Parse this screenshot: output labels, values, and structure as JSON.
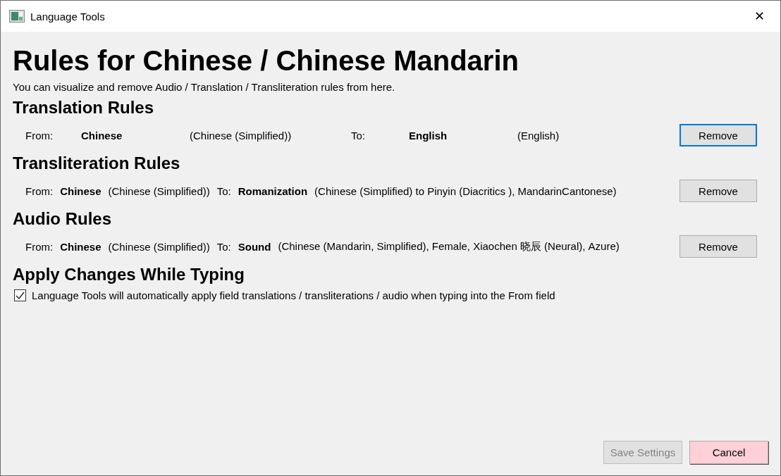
{
  "window": {
    "title": "Language Tools",
    "close": "✕"
  },
  "heading": "Rules for Chinese / Chinese Mandarin",
  "description": "You can visualize and remove Audio / Translation / Transliteration rules from here.",
  "sections": [
    {
      "title": "Translation Rules",
      "rule": {
        "kind": "spread",
        "from_label": "From:",
        "from": "Chinese",
        "from_detail": "(Chinese (Simplified))",
        "to_label": "To:",
        "to": "English",
        "to_detail": "(English)",
        "button": "Remove",
        "focused": true
      }
    },
    {
      "title": "Transliteration Rules",
      "rule": {
        "kind": "compact",
        "from_label": "From:",
        "from": "Chinese",
        "from_detail": "(Chinese (Simplified))",
        "to_label": "To:",
        "to": "Romanization",
        "to_detail": "(Chinese (Simplified) to Pinyin (Diacritics ), MandarinCantonese)",
        "button": "Remove",
        "focused": false
      }
    },
    {
      "title": "Audio Rules",
      "rule": {
        "kind": "compact",
        "from_label": "From:",
        "from": "Chinese",
        "from_detail": "(Chinese (Simplified))",
        "to_label": "To:",
        "to": "Sound",
        "to_detail": "(Chinese (Mandarin, Simplified), Female, Xiaochen 晓辰 (Neural), Azure)",
        "button": "Remove",
        "focused": false
      }
    }
  ],
  "typing": {
    "title": "Apply Changes While Typing",
    "checkbox": {
      "label": "Language Tools will automatically apply field translations / transliterations / audio when typing into the From field",
      "checked": true
    }
  },
  "buttons": [
    {
      "label": "Save Settings",
      "kind": "save",
      "disabled": true
    },
    {
      "label": "Cancel",
      "kind": "cancel",
      "disabled": false
    }
  ]
}
